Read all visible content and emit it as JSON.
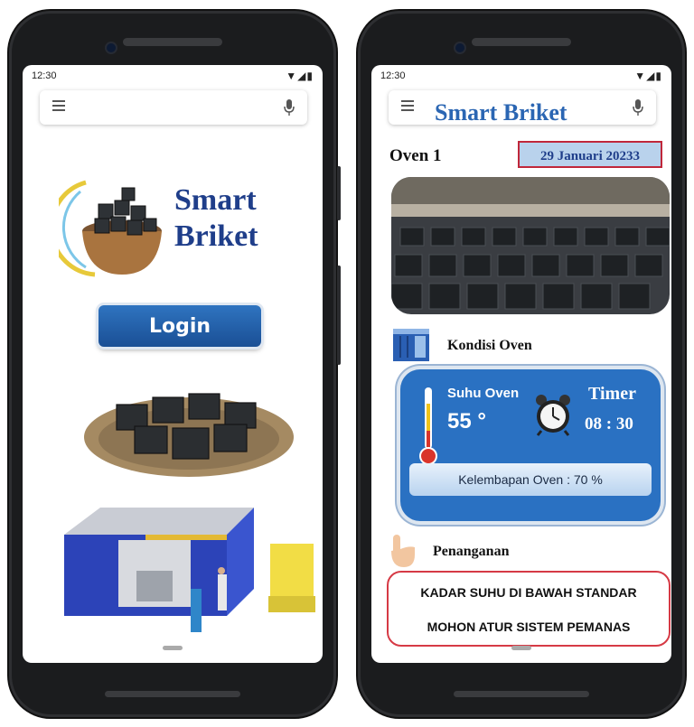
{
  "left_screen": {
    "status_time": "12:30",
    "logo_text_line1": "Smart",
    "logo_text_line2": "Briket",
    "login_label": "Login"
  },
  "right_screen": {
    "status_time": "12:30",
    "app_title": "Smart Briket",
    "oven_name": "Oven 1",
    "date": "29 Januari 20233",
    "section_condition": "Kondisi Oven",
    "temperature_label": "Suhu Oven",
    "temperature_value": "55 °",
    "timer_label": "Timer",
    "timer_value": "08 : 30",
    "humidity_text": "Kelembapan Oven :  70 %",
    "section_handling": "Penanganan",
    "alert_line1": "KADAR SUHU DI BAWAH STANDAR",
    "alert_line2": "MOHON ATUR SISTEM PEMANAS"
  },
  "colors": {
    "brand_blue": "#2b66b3",
    "card_blue": "#2a71c2",
    "alert_red": "#d63a45",
    "phone_frame": "#1b1c1e"
  },
  "icons": [
    "menu-icon",
    "mic-icon",
    "thermometer-icon",
    "alarm-clock-icon",
    "oven-icon",
    "hand-pointer-icon"
  ]
}
